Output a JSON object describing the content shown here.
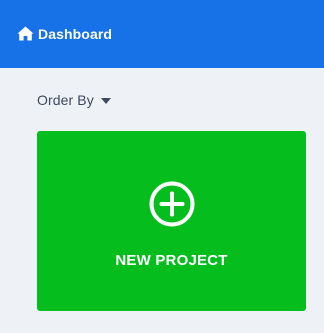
{
  "header": {
    "home_icon": "home-icon",
    "dashboard_label": "Dashboard",
    "background_color": "#1672e6"
  },
  "toolbar": {
    "order_by_label": "Order By",
    "order_by_icon": "caret-down-icon"
  },
  "cards": {
    "new_project": {
      "icon": "plus-circle-icon",
      "label": "NEW PROJECT",
      "color": "#06bd1e"
    }
  }
}
